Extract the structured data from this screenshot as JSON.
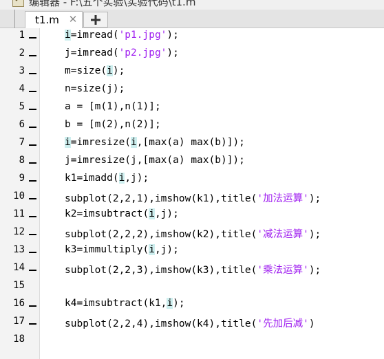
{
  "window": {
    "title": "编辑器 - F:\\五个实验\\实验代码\\t1.m"
  },
  "tabs": [
    {
      "label": "t1.m"
    }
  ],
  "icons": {
    "app": "editor-app-icon",
    "close": "close-icon",
    "add": "plus-icon"
  },
  "colors": {
    "string": "#a020f0",
    "highlight": "#cdeeee",
    "gutter": "#f3f3f3"
  },
  "lines": [
    {
      "num": "1",
      "segs": [
        [
          "i",
          "hl"
        ],
        [
          "=imread("
        ],
        [
          "'p1.jpg'",
          "str"
        ],
        [
          ");"
        ]
      ]
    },
    {
      "num": "2",
      "segs": [
        [
          "j=imread("
        ],
        [
          "'p2.jpg'",
          "str"
        ],
        [
          ");"
        ]
      ]
    },
    {
      "num": "3",
      "segs": [
        [
          "m=size("
        ],
        [
          "i",
          "hl"
        ],
        [
          ");"
        ]
      ]
    },
    {
      "num": "4",
      "segs": [
        [
          "n=size(j);"
        ]
      ]
    },
    {
      "num": "5",
      "segs": [
        [
          "a = [m(1),n(1)];"
        ]
      ]
    },
    {
      "num": "6",
      "segs": [
        [
          "b = [m(2),n(2)];"
        ]
      ]
    },
    {
      "num": "7",
      "segs": [
        [
          "i",
          "hl"
        ],
        [
          "=imresize("
        ],
        [
          "i",
          "hl"
        ],
        [
          ",[max(a) max(b)]);"
        ]
      ]
    },
    {
      "num": "8",
      "segs": [
        [
          "j=imresize(j,[max(a) max(b)]);"
        ]
      ]
    },
    {
      "num": "9",
      "segs": [
        [
          "k1=imadd("
        ],
        [
          "i",
          "hl"
        ],
        [
          ",j);"
        ]
      ]
    },
    {
      "num": "10",
      "segs": [
        [
          "subplot(2,2,1),imshow(k1),title("
        ],
        [
          "'加法运算'",
          "str"
        ],
        [
          ");"
        ]
      ]
    },
    {
      "num": "11",
      "segs": [
        [
          "k2=imsubtract("
        ],
        [
          "i",
          "hl"
        ],
        [
          ",j);"
        ]
      ]
    },
    {
      "num": "12",
      "segs": [
        [
          "subplot(2,2,2),imshow(k2),title("
        ],
        [
          "'减法运算'",
          "str"
        ],
        [
          ");"
        ]
      ]
    },
    {
      "num": "13",
      "segs": [
        [
          "k3=immultiply("
        ],
        [
          "i",
          "hl"
        ],
        [
          ",j);"
        ]
      ]
    },
    {
      "num": "14",
      "segs": [
        [
          "subplot(2,2,3),imshow(k3),title("
        ],
        [
          "'乘法运算'",
          "str"
        ],
        [
          ");"
        ]
      ]
    },
    {
      "num": "15",
      "segs": []
    },
    {
      "num": "16",
      "segs": [
        [
          "k4=imsubtract(k1,"
        ],
        [
          "i",
          "hl"
        ],
        [
          ");"
        ]
      ]
    },
    {
      "num": "17",
      "segs": [
        [
          "subplot(2,2,4),imshow(k4),title("
        ],
        [
          "'先加后减'",
          "str"
        ],
        [
          ")"
        ]
      ]
    },
    {
      "num": "18",
      "segs": []
    }
  ]
}
